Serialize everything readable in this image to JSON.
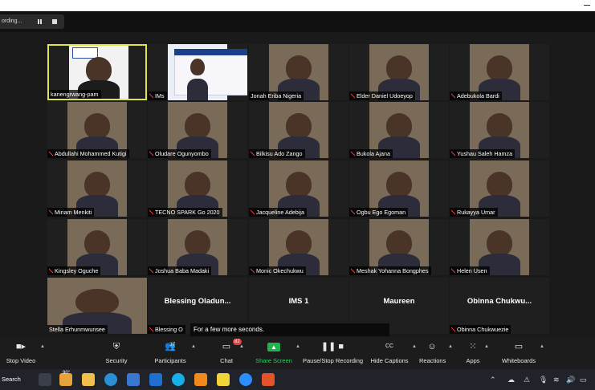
{
  "recording": {
    "label": "ording..."
  },
  "tiles": [
    {
      "name": "kanengrwang-pam",
      "muted": false,
      "type": "video-krp",
      "active": true
    },
    {
      "name": "IMs",
      "muted": true,
      "type": "video-presenter",
      "active": false
    },
    {
      "name": "Jonah Eriba Nigeria",
      "muted": false,
      "type": "video",
      "active": false
    },
    {
      "name": "Elder Daniel Udoeyop",
      "muted": true,
      "type": "video",
      "active": false
    },
    {
      "name": "Adebukola Bardi",
      "muted": true,
      "type": "video",
      "active": false
    },
    {
      "name": "Abdullahi Mohammed Kutigi",
      "muted": true,
      "type": "video",
      "active": false
    },
    {
      "name": "Oludare Ogunyombo",
      "muted": true,
      "type": "video",
      "active": false
    },
    {
      "name": "Bilkisu Ado Zango",
      "muted": true,
      "type": "video",
      "active": false
    },
    {
      "name": "Bukola Ajana",
      "muted": true,
      "type": "video",
      "active": false
    },
    {
      "name": "Yushau Saleh Hamza",
      "muted": true,
      "type": "video",
      "active": false
    },
    {
      "name": "Miriam Menkiti",
      "muted": true,
      "type": "video",
      "active": false
    },
    {
      "name": "TECNO SPARK Go 2020",
      "muted": true,
      "type": "video",
      "active": false
    },
    {
      "name": "Jacqueline Adebija",
      "muted": true,
      "type": "video",
      "active": false
    },
    {
      "name": "Ogbu Ego Egoman",
      "muted": true,
      "type": "video",
      "active": false
    },
    {
      "name": "Rukayya Umar",
      "muted": true,
      "type": "video",
      "active": false
    },
    {
      "name": "Kingsley Oguche",
      "muted": true,
      "type": "video",
      "active": false
    },
    {
      "name": "Joshua Baba Madaki",
      "muted": true,
      "type": "video",
      "active": false
    },
    {
      "name": "Monic Okechukwu",
      "muted": true,
      "type": "video",
      "active": false
    },
    {
      "name": "Meshak Yohanna Bongphes",
      "muted": true,
      "type": "video",
      "active": false
    },
    {
      "name": "Helen Usen",
      "muted": true,
      "type": "video",
      "active": false
    },
    {
      "name": "Stella Erhunmwunsee",
      "muted": false,
      "type": "video-wide",
      "active": false
    },
    {
      "name": "Blessing O",
      "display": "Blessing Oladun...",
      "muted": true,
      "type": "name",
      "active": false
    },
    {
      "name": "",
      "display": "IMS 1",
      "muted": false,
      "type": "name",
      "active": false
    },
    {
      "name": "Maureen",
      "display": "Maureen",
      "muted": true,
      "type": "name",
      "active": false
    },
    {
      "name": "Obinna Chukwuezie",
      "display": "Obinna Chukwu...",
      "muted": true,
      "type": "name",
      "active": false
    }
  ],
  "toast": "For a few more seconds.",
  "toolbar": {
    "stop_video": "Stop Video",
    "security": "Security",
    "participants": "Participants",
    "participants_count": "37",
    "chat": "Chat",
    "chat_badge": "82",
    "share_screen": "Share Screen",
    "pause_recording": "Pause/Stop Recording",
    "captions": "Hide Captions",
    "captions_icon": "CC",
    "reactions": "Reactions",
    "apps": "Apps",
    "whiteboards": "Whiteboards"
  },
  "taskbar": {
    "search": "Search",
    "weather": "90°"
  },
  "colors": {
    "active_border": "#e0e34a",
    "muted_icon": "#e23b3b",
    "share_green": "#23b24c"
  }
}
